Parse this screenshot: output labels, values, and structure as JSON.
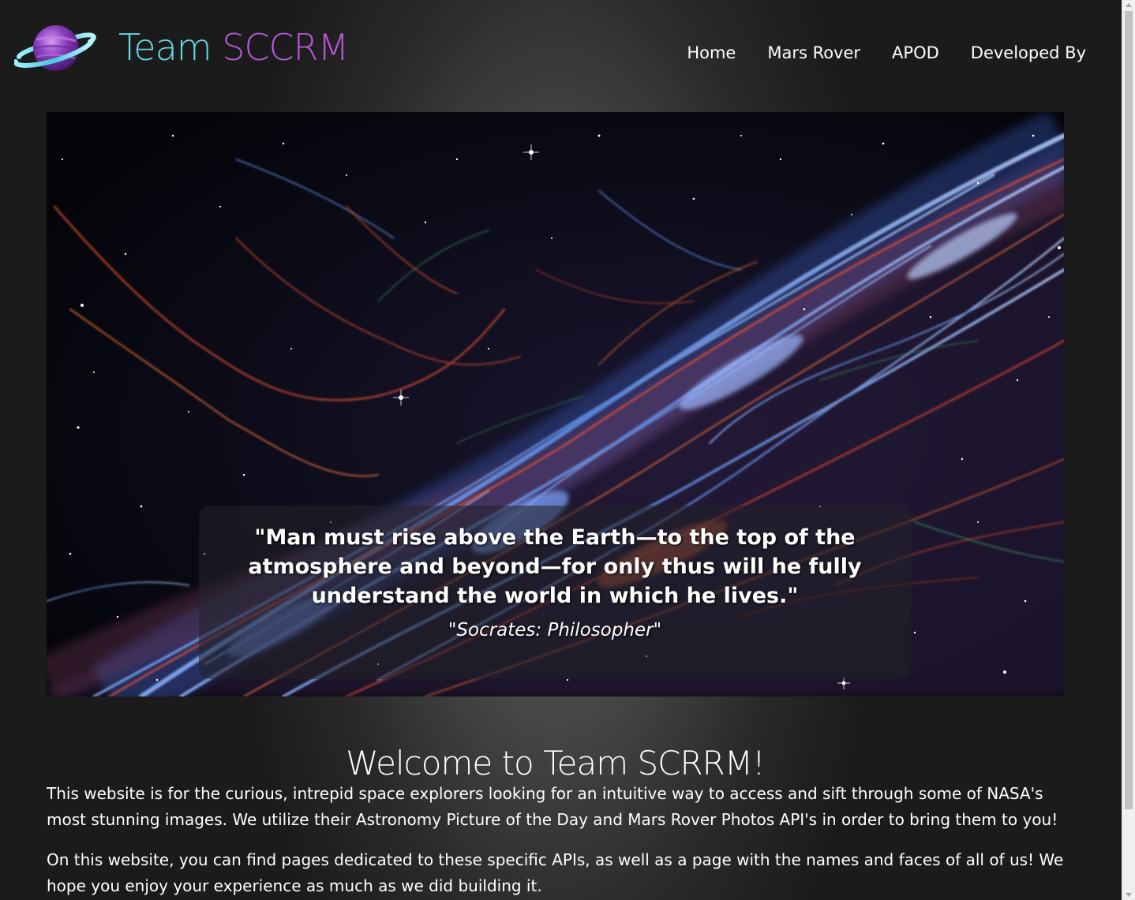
{
  "brand": {
    "name_part1": "Team",
    "name_part2": "SCCRM",
    "logo_icon": "planet-icon"
  },
  "nav": {
    "items": [
      {
        "label": "Home"
      },
      {
        "label": "Mars Rover"
      },
      {
        "label": "APOD"
      },
      {
        "label": "Developed By"
      }
    ]
  },
  "hero": {
    "image": "veil-nebula-image",
    "quote": "\"Man must rise above the Earth—to the top of the atmosphere and beyond—for only thus will he fully understand the world in which he lives.\"",
    "attribution": "\"Socrates: Philosopher\""
  },
  "main": {
    "heading": "Welcome to Team SCRRM!",
    "paragraphs": [
      "This website is for the curious, intrepid space explorers looking for an intuitive way to access and sift through some of NASA's most stunning images. We utilize their Astronomy Picture of the Day and Mars Rover Photos API's in order to bring them to you!",
      "On this website, you can find pages dedicated to these specific APIs, as well as a page with the names and faces of all of us! We hope you enjoy your experience as much as we did building it."
    ]
  },
  "colors": {
    "brand_cyan": "#66d8e8",
    "brand_purple": "#b657d6",
    "background_dark": "#1b1b1b",
    "background_center": "#6a6a6a"
  }
}
